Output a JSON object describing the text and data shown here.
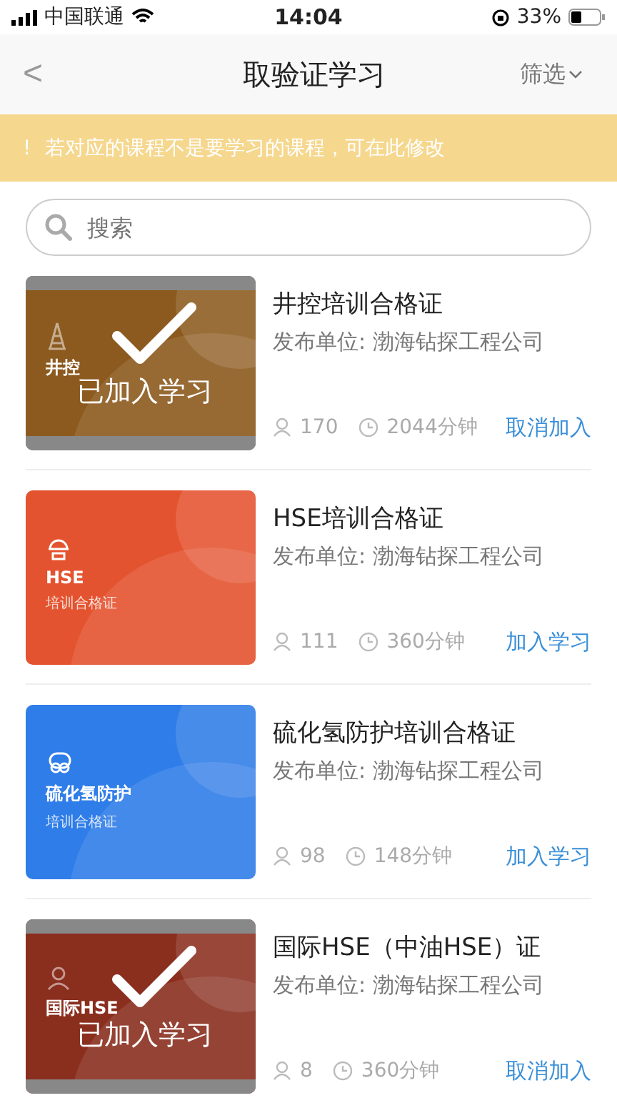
{
  "status_bar": {
    "carrier": "中国联通",
    "time": "14:04",
    "battery": "33%"
  },
  "nav": {
    "back": "<",
    "title": "取验证学习",
    "filter": "筛选"
  },
  "notice": {
    "icon": "!",
    "text": "若对应的课程不是要学习的课程，可在此修改"
  },
  "search": {
    "placeholder": "搜索"
  },
  "courses": [
    {
      "title": "井控培训合格证",
      "publisher": "发布单位: 渤海钻探工程公司",
      "learners": "170",
      "duration": "2044分钟",
      "action": "取消加入",
      "joined": true,
      "joined_label": "已加入学习",
      "color": "#8c5a1e",
      "kind": "derrick",
      "card_lines": [
        "井控"
      ]
    },
    {
      "title": "HSE培训合格证",
      "publisher": "发布单位: 渤海钻探工程公司",
      "learners": "111",
      "duration": "360分钟",
      "action": "加入学习",
      "joined": false,
      "color": "#e4532f",
      "kind": "helmet",
      "card_lines": [
        "HSE",
        "培训合格证"
      ]
    },
    {
      "title": "硫化氢防护培训合格证",
      "publisher": "发布单位: 渤海钻探工程公司",
      "learners": "98",
      "duration": "148分钟",
      "action": "加入学习",
      "joined": false,
      "color": "#2f7de8",
      "kind": "mask",
      "card_lines": [
        "硫化氢防护",
        "培训合格证"
      ]
    },
    {
      "title": "国际HSE（中油HSE）证",
      "publisher": "发布单位: 渤海钻探工程公司",
      "learners": "8",
      "duration": "360分钟",
      "action": "取消加入",
      "joined": true,
      "joined_label": "已加入学习",
      "color": "#8a2e1e",
      "kind": "person",
      "card_lines": [
        "国际HSE"
      ]
    }
  ]
}
